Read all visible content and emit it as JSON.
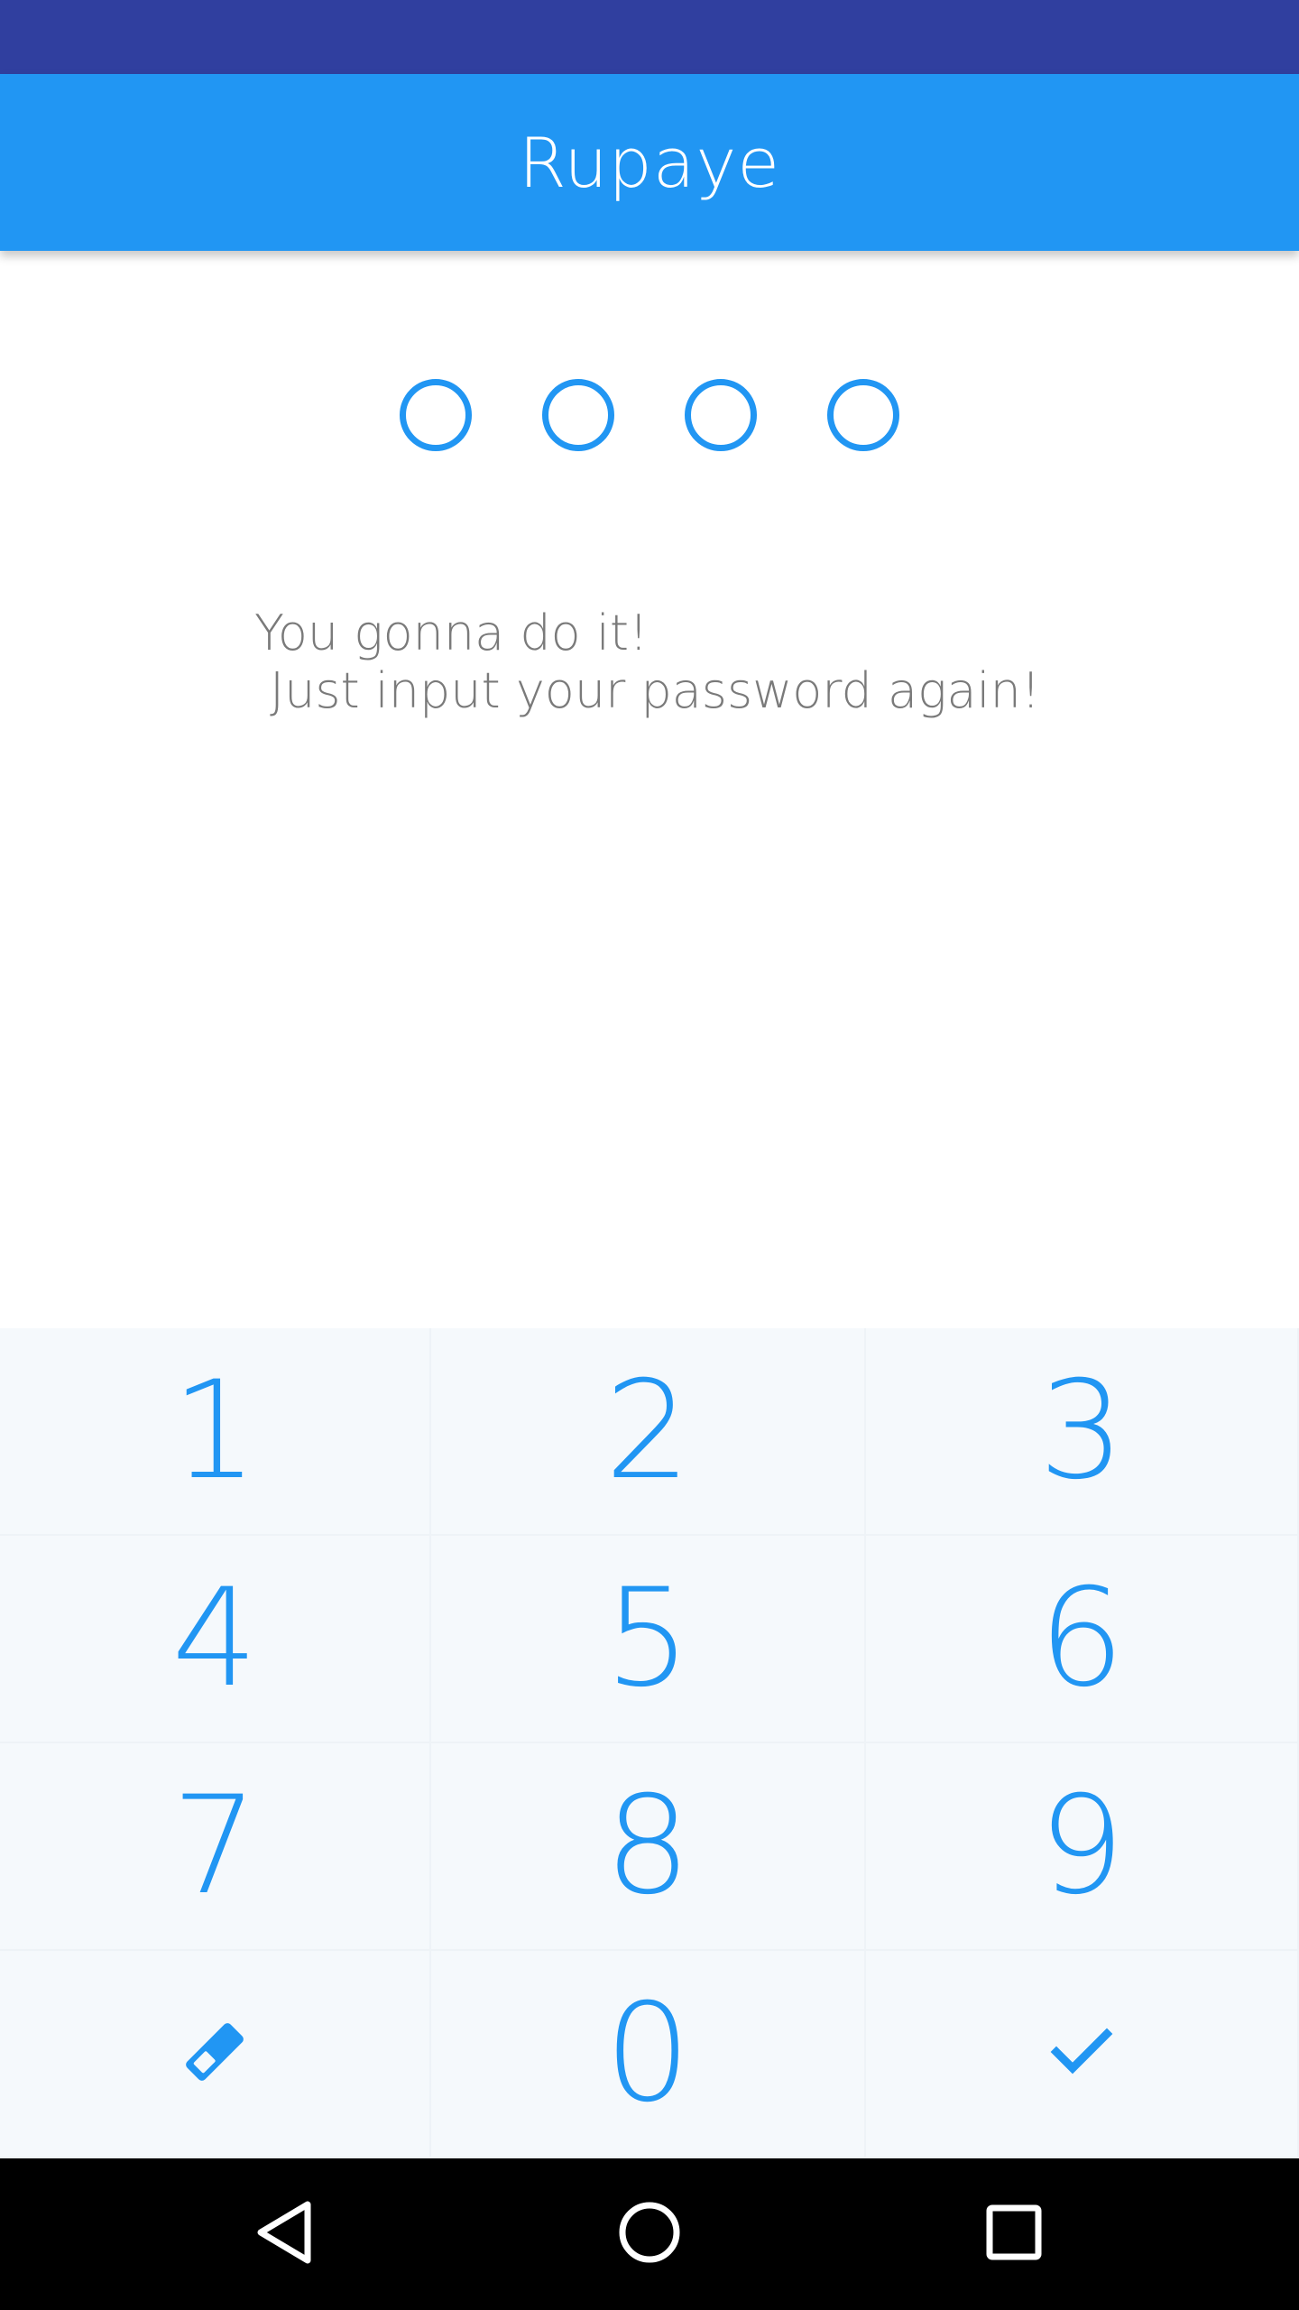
{
  "colors": {
    "status_bar": "#303F9F",
    "accent": "#2196F3",
    "message_text": "#7A7A7A"
  },
  "app_bar": {
    "title": "Rupaye"
  },
  "pin": {
    "length": 4,
    "filled": 0
  },
  "message": {
    "text": "You gonna do it!\n Just input your password again!"
  },
  "keypad": {
    "keys": [
      "1",
      "2",
      "3",
      "4",
      "5",
      "6",
      "7",
      "8",
      "9",
      "0"
    ],
    "clear_icon": "eraser-icon",
    "confirm_icon": "check-icon"
  },
  "nav_bar": {
    "back_icon": "back-triangle-icon",
    "home_icon": "home-circle-icon",
    "recents_icon": "recents-square-icon"
  }
}
